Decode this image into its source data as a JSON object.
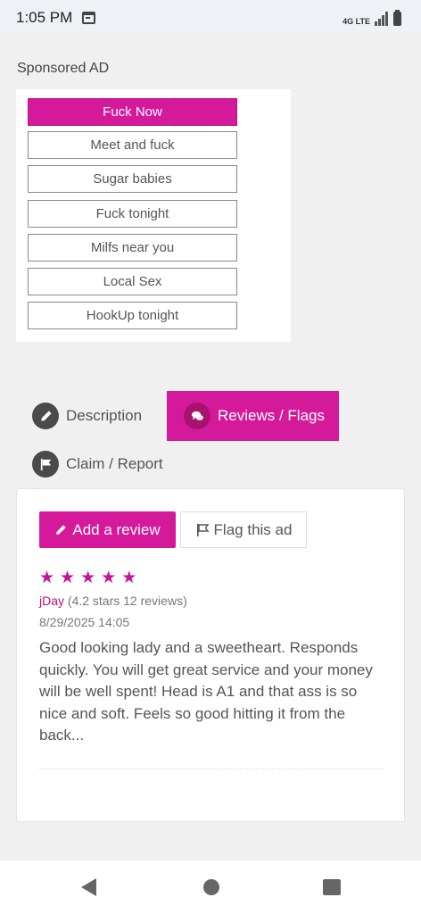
{
  "status_bar": {
    "time": "1:05 PM",
    "network": "4G LTE",
    "icons": [
      "calendar-icon",
      "signal-icon",
      "battery-icon"
    ]
  },
  "sponsored": {
    "label": "Sponsored AD",
    "buttons": [
      "Fuck Now",
      "Meet and fuck",
      "Sugar babies",
      "Fuck tonight",
      "Milfs near you",
      "Local Sex",
      "HookUp tonight"
    ]
  },
  "tabs": {
    "description": "Description",
    "reviews": "Reviews / Flags",
    "claim": "Claim / Report",
    "active": "reviews"
  },
  "panel": {
    "add_review_label": "Add a review",
    "flag_label": "Flag this ad"
  },
  "review": {
    "stars": 5,
    "reviewer": "jDay",
    "reviewer_stats": "(4.2 stars 12 reviews)",
    "date": "8/29/2025 14:05",
    "text": "Good looking lady and a sweetheart. Responds quickly. You will get great service and your money will be well spent! Head is A1 and that ass is so nice and soft. Feels so good hitting it from the back..."
  },
  "colors": {
    "accent": "#d5199b",
    "star": "#c41597",
    "background": "#f0f0f0"
  }
}
